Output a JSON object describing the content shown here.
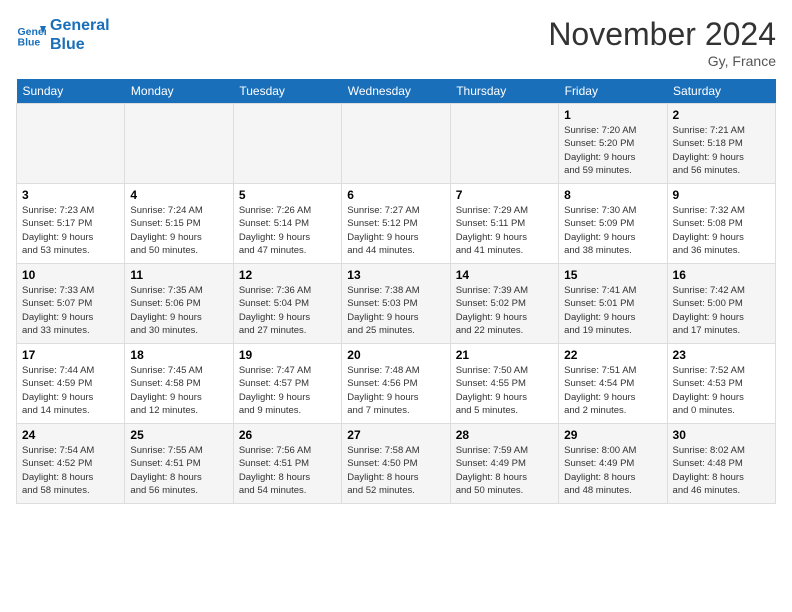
{
  "header": {
    "logo_line1": "General",
    "logo_line2": "Blue",
    "month": "November 2024",
    "location": "Gy, France"
  },
  "weekdays": [
    "Sunday",
    "Monday",
    "Tuesday",
    "Wednesday",
    "Thursday",
    "Friday",
    "Saturday"
  ],
  "weeks": [
    [
      {
        "day": "",
        "info": ""
      },
      {
        "day": "",
        "info": ""
      },
      {
        "day": "",
        "info": ""
      },
      {
        "day": "",
        "info": ""
      },
      {
        "day": "",
        "info": ""
      },
      {
        "day": "1",
        "info": "Sunrise: 7:20 AM\nSunset: 5:20 PM\nDaylight: 9 hours\nand 59 minutes."
      },
      {
        "day": "2",
        "info": "Sunrise: 7:21 AM\nSunset: 5:18 PM\nDaylight: 9 hours\nand 56 minutes."
      }
    ],
    [
      {
        "day": "3",
        "info": "Sunrise: 7:23 AM\nSunset: 5:17 PM\nDaylight: 9 hours\nand 53 minutes."
      },
      {
        "day": "4",
        "info": "Sunrise: 7:24 AM\nSunset: 5:15 PM\nDaylight: 9 hours\nand 50 minutes."
      },
      {
        "day": "5",
        "info": "Sunrise: 7:26 AM\nSunset: 5:14 PM\nDaylight: 9 hours\nand 47 minutes."
      },
      {
        "day": "6",
        "info": "Sunrise: 7:27 AM\nSunset: 5:12 PM\nDaylight: 9 hours\nand 44 minutes."
      },
      {
        "day": "7",
        "info": "Sunrise: 7:29 AM\nSunset: 5:11 PM\nDaylight: 9 hours\nand 41 minutes."
      },
      {
        "day": "8",
        "info": "Sunrise: 7:30 AM\nSunset: 5:09 PM\nDaylight: 9 hours\nand 38 minutes."
      },
      {
        "day": "9",
        "info": "Sunrise: 7:32 AM\nSunset: 5:08 PM\nDaylight: 9 hours\nand 36 minutes."
      }
    ],
    [
      {
        "day": "10",
        "info": "Sunrise: 7:33 AM\nSunset: 5:07 PM\nDaylight: 9 hours\nand 33 minutes."
      },
      {
        "day": "11",
        "info": "Sunrise: 7:35 AM\nSunset: 5:06 PM\nDaylight: 9 hours\nand 30 minutes."
      },
      {
        "day": "12",
        "info": "Sunrise: 7:36 AM\nSunset: 5:04 PM\nDaylight: 9 hours\nand 27 minutes."
      },
      {
        "day": "13",
        "info": "Sunrise: 7:38 AM\nSunset: 5:03 PM\nDaylight: 9 hours\nand 25 minutes."
      },
      {
        "day": "14",
        "info": "Sunrise: 7:39 AM\nSunset: 5:02 PM\nDaylight: 9 hours\nand 22 minutes."
      },
      {
        "day": "15",
        "info": "Sunrise: 7:41 AM\nSunset: 5:01 PM\nDaylight: 9 hours\nand 19 minutes."
      },
      {
        "day": "16",
        "info": "Sunrise: 7:42 AM\nSunset: 5:00 PM\nDaylight: 9 hours\nand 17 minutes."
      }
    ],
    [
      {
        "day": "17",
        "info": "Sunrise: 7:44 AM\nSunset: 4:59 PM\nDaylight: 9 hours\nand 14 minutes."
      },
      {
        "day": "18",
        "info": "Sunrise: 7:45 AM\nSunset: 4:58 PM\nDaylight: 9 hours\nand 12 minutes."
      },
      {
        "day": "19",
        "info": "Sunrise: 7:47 AM\nSunset: 4:57 PM\nDaylight: 9 hours\nand 9 minutes."
      },
      {
        "day": "20",
        "info": "Sunrise: 7:48 AM\nSunset: 4:56 PM\nDaylight: 9 hours\nand 7 minutes."
      },
      {
        "day": "21",
        "info": "Sunrise: 7:50 AM\nSunset: 4:55 PM\nDaylight: 9 hours\nand 5 minutes."
      },
      {
        "day": "22",
        "info": "Sunrise: 7:51 AM\nSunset: 4:54 PM\nDaylight: 9 hours\nand 2 minutes."
      },
      {
        "day": "23",
        "info": "Sunrise: 7:52 AM\nSunset: 4:53 PM\nDaylight: 9 hours\nand 0 minutes."
      }
    ],
    [
      {
        "day": "24",
        "info": "Sunrise: 7:54 AM\nSunset: 4:52 PM\nDaylight: 8 hours\nand 58 minutes."
      },
      {
        "day": "25",
        "info": "Sunrise: 7:55 AM\nSunset: 4:51 PM\nDaylight: 8 hours\nand 56 minutes."
      },
      {
        "day": "26",
        "info": "Sunrise: 7:56 AM\nSunset: 4:51 PM\nDaylight: 8 hours\nand 54 minutes."
      },
      {
        "day": "27",
        "info": "Sunrise: 7:58 AM\nSunset: 4:50 PM\nDaylight: 8 hours\nand 52 minutes."
      },
      {
        "day": "28",
        "info": "Sunrise: 7:59 AM\nSunset: 4:49 PM\nDaylight: 8 hours\nand 50 minutes."
      },
      {
        "day": "29",
        "info": "Sunrise: 8:00 AM\nSunset: 4:49 PM\nDaylight: 8 hours\nand 48 minutes."
      },
      {
        "day": "30",
        "info": "Sunrise: 8:02 AM\nSunset: 4:48 PM\nDaylight: 8 hours\nand 46 minutes."
      }
    ]
  ]
}
